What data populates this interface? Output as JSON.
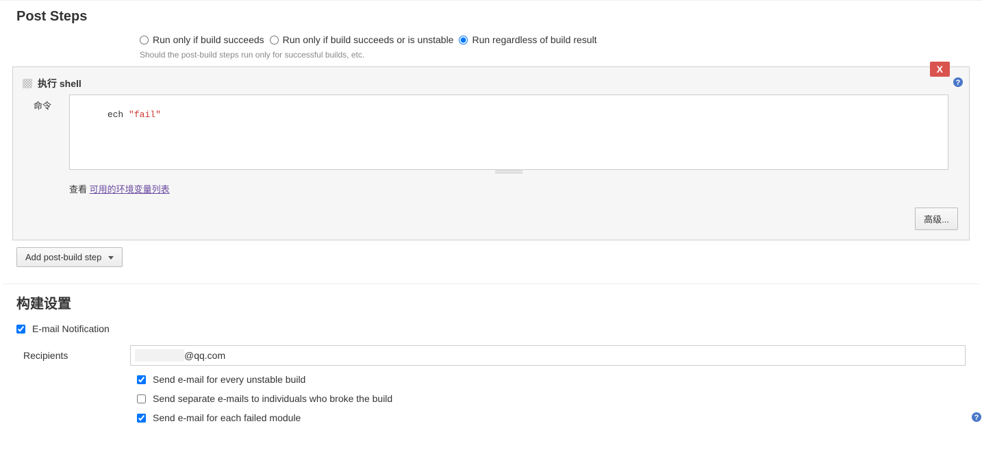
{
  "postSteps": {
    "title": "Post Steps",
    "radios": {
      "succeeds": "Run only if build succeeds",
      "succeedsOrUnstable": "Run only if build succeeds or is unstable",
      "regardless": "Run regardless of build result"
    },
    "helpText": "Should the post-build steps run only for successful builds, etc.",
    "shell": {
      "blockTitle": "执行 shell",
      "commandLabel": "命令",
      "commandParts": {
        "cmd": "ech ",
        "q1": "\"",
        "str": "fail",
        "q2": "\""
      },
      "envLinkPrefix": "查看 ",
      "envLinkText": "可用的环境变量列表",
      "advanced": "高级...",
      "closeLabel": "X"
    },
    "addStep": "Add post-build step"
  },
  "buildSettings": {
    "title": "构建设置",
    "emailNotification": {
      "label": "E-mail Notification",
      "checked": true,
      "recipientsLabel": "Recipients",
      "recipientsTail": "@qq.com",
      "unstable": {
        "label": "Send e-mail for every unstable build",
        "checked": true
      },
      "broke": {
        "label": "Send separate e-mails to individuals who broke the build",
        "checked": false
      },
      "failedModule": {
        "label": "Send e-mail for each failed module",
        "checked": true
      }
    }
  }
}
